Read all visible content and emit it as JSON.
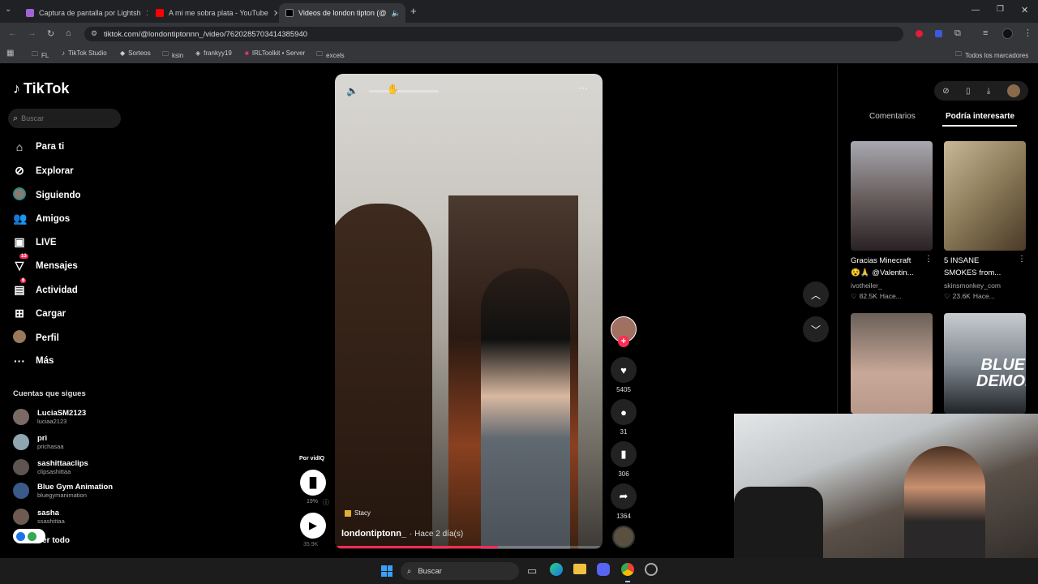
{
  "browser": {
    "tabs": [
      {
        "title": "Captura de pantalla por Lightsh",
        "active": false
      },
      {
        "title": "A mi me sobra plata - YouTube",
        "active": false
      },
      {
        "title": "Videos de london tipton (@",
        "active": true
      }
    ],
    "new_tab": "+",
    "url": "tiktok.com/@londontiptonnn_/video/7620285703414385940",
    "bookmarks": [
      "FL",
      "TikTok Studio",
      "Sorteos",
      "ksin",
      "frankyy19",
      "IRLToolkit • Server",
      "excels"
    ],
    "all_bookmarks": "Todos los marcadores"
  },
  "tiktok": {
    "logo": "TikTok",
    "search_placeholder": "Buscar",
    "nav": [
      {
        "label": "Para ti",
        "icon": "home-icon"
      },
      {
        "label": "Explorar",
        "icon": "compass-icon"
      },
      {
        "label": "Siguiendo",
        "icon": "following-avatar-icon"
      },
      {
        "label": "Amigos",
        "icon": "friends-icon"
      },
      {
        "label": "LIVE",
        "icon": "live-icon"
      },
      {
        "label": "Mensajes",
        "icon": "messages-icon",
        "badge": "13"
      },
      {
        "label": "Actividad",
        "icon": "activity-icon",
        "badge": "6"
      },
      {
        "label": "Cargar",
        "icon": "upload-icon"
      },
      {
        "label": "Perfil",
        "icon": "profile-avatar-icon"
      },
      {
        "label": "Más",
        "icon": "more-icon"
      }
    ],
    "following_title": "Cuentas que sigues",
    "following": [
      {
        "name": "LuciaSM2123",
        "handle": "luciaa2123"
      },
      {
        "name": "pri",
        "handle": "prichasaa"
      },
      {
        "name": "sashittaaclips",
        "handle": "clipsashittaa"
      },
      {
        "name": "Blue Gym Animation",
        "handle": "bluegymanimation"
      },
      {
        "name": "sasha",
        "handle": "ssashittaa"
      }
    ],
    "see_all": "Ver todo"
  },
  "video": {
    "author": "londontiptonn_",
    "time": "· Hace 2 día(s)",
    "sound": "Stacy",
    "likes": "5405",
    "comments": "31",
    "saves": "306",
    "shares": "1364",
    "progress": 0.61
  },
  "poll": {
    "label": "Por vidIQ",
    "percent": "19%",
    "views": "35.9K"
  },
  "right_panel": {
    "tabs": [
      "Comentarios",
      "Podría interesarte"
    ],
    "active_tab": "Podría interesarte",
    "cards": [
      {
        "title": "Gracias Minecraft",
        "title2": "😵🙏 @Valentin...",
        "author": "ivotheiler_",
        "likes": "82.5K",
        "time": "Hace..."
      },
      {
        "title": "5 INSANE",
        "title2": "SMOKES from...",
        "author": "skinsmonkey_com",
        "likes": "23.6K",
        "time": "Hace..."
      },
      {
        "title": "",
        "title2": "",
        "author": "",
        "likes": "",
        "time": ""
      },
      {
        "title": "BLUE DEMON",
        "title2": "",
        "author": "",
        "likes": "",
        "time": ""
      }
    ]
  },
  "taskbar": {
    "search": "Buscar"
  }
}
